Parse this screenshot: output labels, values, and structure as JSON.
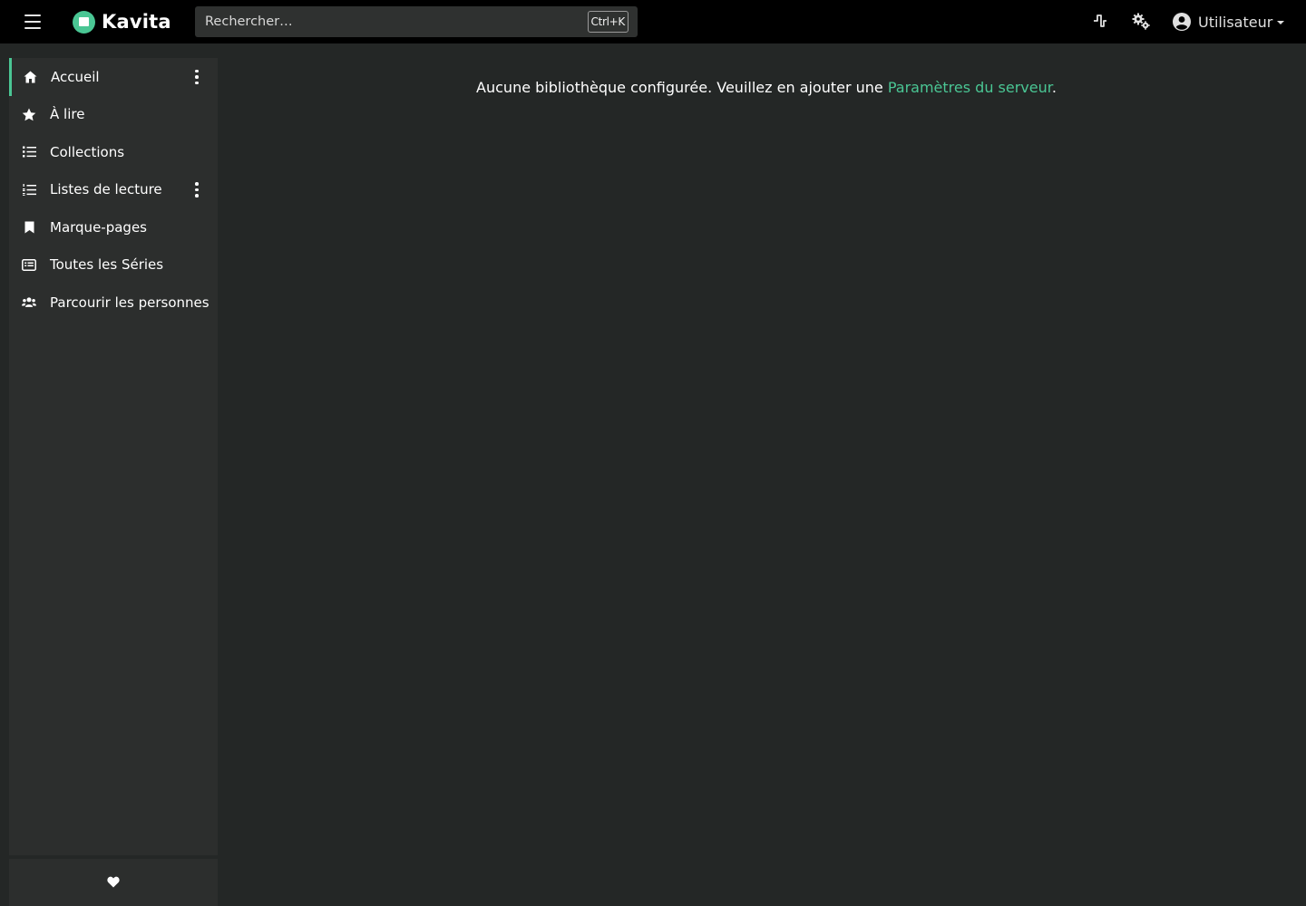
{
  "app": {
    "name": "Kavita"
  },
  "header": {
    "search_placeholder": "Rechercher…",
    "search_shortcut": "Ctrl+K",
    "user_label": "Utilisateur"
  },
  "sidebar": {
    "items": [
      {
        "label": "Accueil",
        "icon": "home-icon",
        "active": true,
        "has_menu": true
      },
      {
        "label": "À lire",
        "icon": "star-icon",
        "active": false,
        "has_menu": false
      },
      {
        "label": "Collections",
        "icon": "list-icon",
        "active": false,
        "has_menu": false
      },
      {
        "label": "Listes de lecture",
        "icon": "ordered-list-icon",
        "active": false,
        "has_menu": true
      },
      {
        "label": "Marque-pages",
        "icon": "bookmark-icon",
        "active": false,
        "has_menu": false
      },
      {
        "label": "Toutes les Séries",
        "icon": "rectangle-list-icon",
        "active": false,
        "has_menu": false
      },
      {
        "label": "Parcourir les personnes",
        "icon": "users-icon",
        "active": false,
        "has_menu": false
      }
    ]
  },
  "main": {
    "empty_message": "Aucune bibliothèque configurée. Veuillez en ajouter une ",
    "settings_link": "Paramètres du serveur",
    "trailing": "."
  },
  "colors": {
    "accent": "#4ac694",
    "navbar_bg": "#000000",
    "sidebar_bg": "#2c2e2d",
    "page_bg": "#242726"
  }
}
